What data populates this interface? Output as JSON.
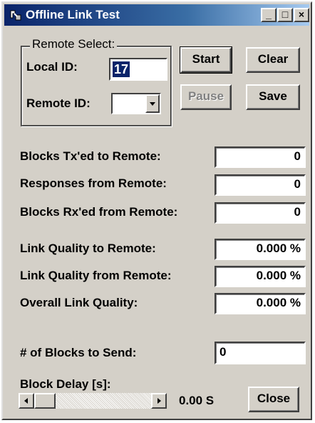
{
  "window": {
    "title": "Offline Link Test"
  },
  "titlebar_buttons": {
    "minimize": "_",
    "maximize": "□",
    "close": "×"
  },
  "remote_select": {
    "group_label": "Remote Select:",
    "local_id_label": "Local ID:",
    "local_id_value": "17",
    "remote_id_label": "Remote ID:",
    "remote_id_value": ""
  },
  "buttons": {
    "start": "Start",
    "clear": "Clear",
    "pause": "Pause",
    "save": "Save",
    "close": "Close"
  },
  "stats": {
    "blocks_tx_label": "Blocks Tx'ed to Remote:",
    "blocks_tx_value": "0",
    "responses_label": "Responses from Remote:",
    "responses_value": "0",
    "blocks_rx_label": "Blocks Rx'ed from Remote:",
    "blocks_rx_value": "0",
    "quality_to_label": "Link Quality to Remote:",
    "quality_to_value": "0.000 %",
    "quality_from_label": "Link Quality from Remote:",
    "quality_from_value": "0.000 %",
    "overall_label": "Overall Link Quality:",
    "overall_value": "0.000 %"
  },
  "send": {
    "blocks_label": "# of Blocks to Send:",
    "blocks_value": "0"
  },
  "delay": {
    "label": "Block Delay [s]:",
    "value": "0.00 S",
    "slider_level": 0
  }
}
